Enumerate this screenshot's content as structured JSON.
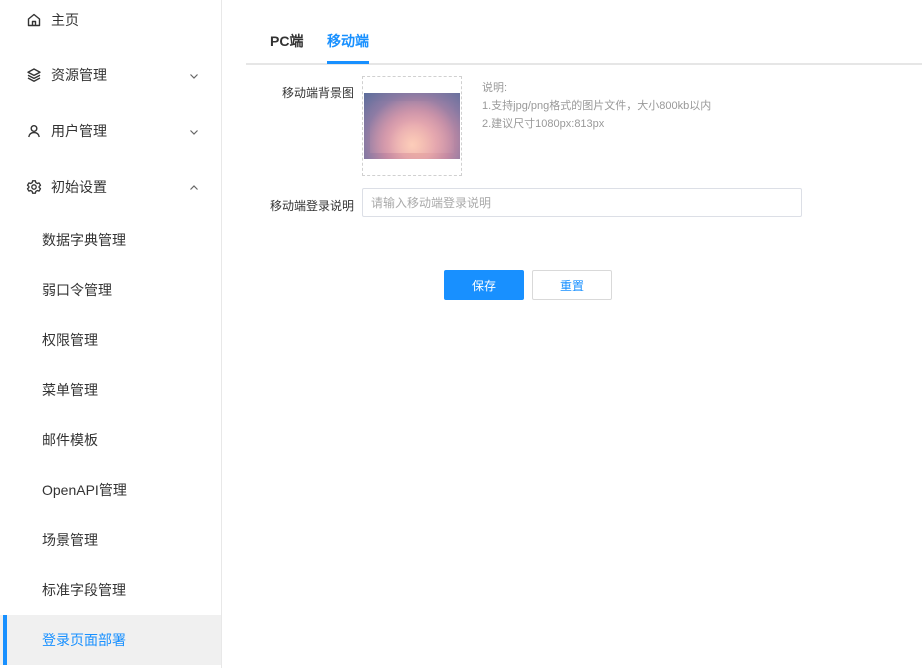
{
  "sidebar": {
    "items": [
      {
        "label": "主页",
        "icon": "home-icon"
      },
      {
        "label": "资源管理",
        "icon": "layers-icon",
        "expanded": false
      },
      {
        "label": "用户管理",
        "icon": "user-icon",
        "expanded": false
      },
      {
        "label": "初始设置",
        "icon": "gear-icon",
        "expanded": true
      }
    ],
    "sub_items": [
      {
        "label": "数据字典管理"
      },
      {
        "label": "弱口令管理"
      },
      {
        "label": "权限管理"
      },
      {
        "label": "菜单管理"
      },
      {
        "label": "邮件模板"
      },
      {
        "label": "OpenAPI管理"
      },
      {
        "label": "场景管理"
      },
      {
        "label": "标准字段管理"
      },
      {
        "label": "登录页面部署",
        "active": true
      }
    ]
  },
  "tabs": {
    "pc": "PC端",
    "mobile": "移动端",
    "active": "mobile"
  },
  "form": {
    "bg_label": "移动端背景图",
    "hint_title": "说明:",
    "hint_line1": "1.支持jpg/png格式的图片文件，大小800kb以内",
    "hint_line2": "2.建议尺寸1080px:813px",
    "desc_label": "移动端登录说明",
    "desc_placeholder": "请输入移动端登录说明",
    "desc_value": ""
  },
  "buttons": {
    "save": "保存",
    "reset": "重置"
  },
  "colors": {
    "accent": "#1890ff",
    "active_bg": "#f0f0f0"
  }
}
